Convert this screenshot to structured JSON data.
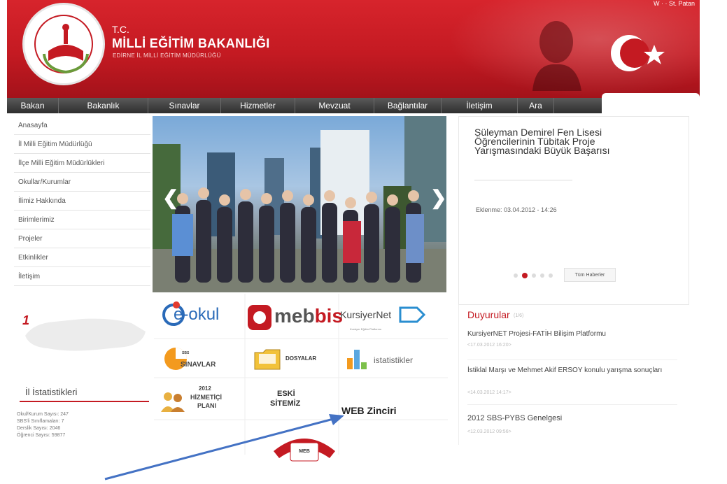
{
  "header": {
    "tc": "T.C.",
    "ministry": "MİLLİ EĞİTİM BAKANLIĞI",
    "directorate": "EDİRNE İL MİLLİ EĞİTİM MÜDÜRLÜĞÜ",
    "top_link": "W  · · St. Patan"
  },
  "nav": {
    "items": [
      {
        "label": "Bakan",
        "width": 74
      },
      {
        "label": "Bakanlık",
        "width": 128
      },
      {
        "label": "Sınavlar",
        "width": 104
      },
      {
        "label": "Hizmetler",
        "width": 106
      },
      {
        "label": "Mevzuat",
        "width": 113
      },
      {
        "label": "Bağlantılar",
        "width": 96
      },
      {
        "label": "İletişim",
        "width": 109
      },
      {
        "label": "Ara",
        "width": 52
      }
    ]
  },
  "sidebar": {
    "items": [
      {
        "label": "Anasayfa",
        "name": "sidebar-item-anasayfa"
      },
      {
        "label": "İl Milli Eğitim Müdürlüğü",
        "name": "sidebar-item-il-mem"
      },
      {
        "label": "İlçe Milli Eğitim Müdürlükleri",
        "name": "sidebar-item-ilce-mem"
      },
      {
        "label": "Okullar/Kurumlar",
        "name": "sidebar-item-okullar"
      },
      {
        "label": "İlimiz Hakkında",
        "name": "sidebar-item-ilimiz"
      },
      {
        "label": "Birimlerimiz",
        "name": "sidebar-item-birimlerimiz"
      },
      {
        "label": "Projeler",
        "name": "sidebar-item-projeler"
      },
      {
        "label": "Etkinlikler",
        "name": "sidebar-item-etkinlikler"
      },
      {
        "label": "İletişim",
        "name": "sidebar-item-iletisim"
      }
    ]
  },
  "map": {
    "marker": "1"
  },
  "stats": {
    "title": "İl İstatistikleri",
    "rows": [
      "Okul/Kurum Sayısı: 247",
      "SBS'li Sınıflamaları: 7",
      "Derslik Sayısı: 2046",
      "Öğrenci Sayısı: 59877"
    ]
  },
  "news": {
    "title": "Süleyman Demirel Fen Lisesi Öğrencilerinin Tübitak Proje Yarışmasındaki Büyük Başarısı",
    "date": "Eklenme: 03.04.2012 - 14:26",
    "all_label": "Tüm Haberler"
  },
  "tiles": {
    "eokul": "e-okul",
    "mebbis_a": "meb",
    "mebbis_b": "bis",
    "kursiyer": "KursiyerNet",
    "kursiyer_sub": "Kursiyer Eğitim Platformu",
    "sbs_badge": "SBS",
    "sbs_label": "SINAVLAR",
    "dosya_label": "DOSYALAR",
    "istatistik_label": "istatistikler",
    "hizmetici_year": "2012",
    "hizmetici_a": "HİZMETİÇİ",
    "hizmetici_b": "PLANI",
    "eski_a": "ESKİ",
    "eski_b": "SİTEMİZ",
    "web_zinciri": "WEB Zinciri",
    "meb_phone": "MEB"
  },
  "announcements": {
    "title": "Duyurular",
    "count": "(1/6)",
    "items": [
      {
        "text": "KursiyerNET Projesi-FATİH Bilişim Platformu",
        "date": "<17.03.2012 16:20>"
      },
      {
        "text": "İstiklal Marşı ve Mehmet Akif ERSOY konulu yarışma sonuçları",
        "date": "<14.03.2012 14:17>"
      },
      {
        "text": "2012 SBS-PYBS Genelgesi",
        "date": "<12.03.2012 09:56>"
      }
    ]
  },
  "colors": {
    "brand_red": "#c41a22",
    "nav_dark": "#2e2e2e",
    "arrow_blue": "#4472c4"
  }
}
